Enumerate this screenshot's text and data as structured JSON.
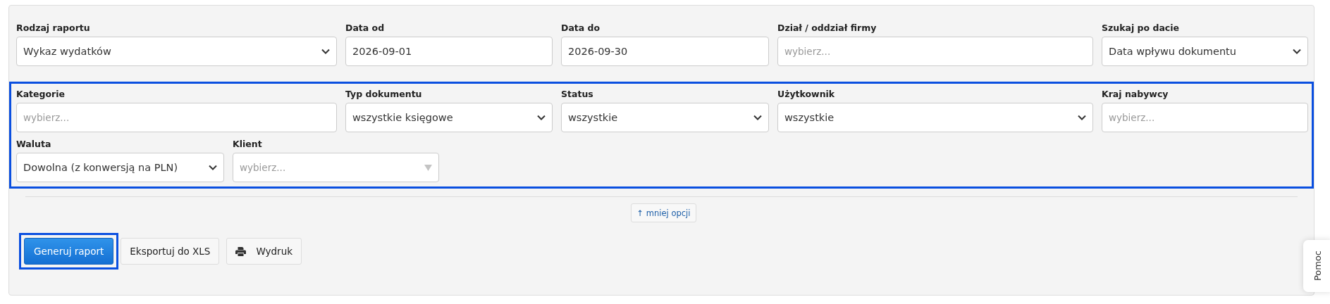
{
  "filters": [
    {
      "label": "Rodzaj raportu",
      "kind": "select",
      "value": "Wykaz wydatków"
    },
    {
      "label": "Data od",
      "kind": "input",
      "value": "2026-09-01"
    },
    {
      "label": "Data do",
      "kind": "input",
      "value": "2026-09-30"
    },
    {
      "label": "Dział / oddział firmy",
      "kind": "input",
      "placeholder": "wybierz..."
    },
    {
      "label": "Szukaj po dacie",
      "kind": "select",
      "value": "Data wpływu dokumentu"
    }
  ],
  "advanced": {
    "highlighted": true,
    "rows": [
      [
        {
          "label": "Kategorie",
          "kind": "input",
          "placeholder": "wybierz..."
        },
        {
          "label": "Typ dokumentu",
          "kind": "select",
          "value": "wszystkie księgowe"
        },
        {
          "label": "Status",
          "kind": "select",
          "value": "wszystkie"
        },
        {
          "label": "Użytkownik",
          "kind": "select",
          "value": "wszystkie"
        },
        {
          "label": "Kraj nabywcy",
          "kind": "input",
          "placeholder": "wybierz..."
        }
      ],
      [
        {
          "label": "Waluta",
          "kind": "select",
          "value": "Dowolna (z konwersją na PLN)"
        },
        {
          "label": "Klient",
          "kind": "combobox",
          "placeholder": "wybierz..."
        }
      ]
    ]
  },
  "toggle": {
    "label": "↑ mniej opcji"
  },
  "actions": [
    {
      "label": "Generuj raport",
      "kind": "primary",
      "highlighted": true
    },
    {
      "label": "Eksportuj do XLS",
      "kind": "default",
      "highlighted": false
    },
    {
      "label": "Wydruk",
      "kind": "print",
      "highlighted": false
    }
  ],
  "help_tab": {
    "label": "Pomoc"
  }
}
